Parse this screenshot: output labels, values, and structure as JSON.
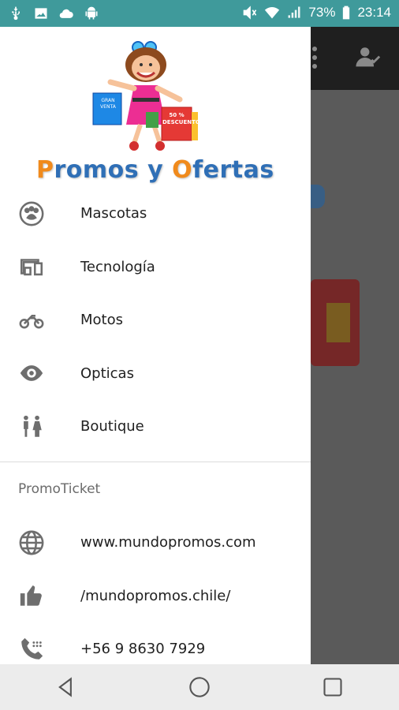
{
  "status_bar": {
    "battery": "73%",
    "time": "23:14",
    "left_icons": [
      "usb-icon",
      "image-icon",
      "cloud-icon",
      "android-icon"
    ],
    "right_icons": [
      "mute-icon",
      "wifi-icon",
      "signal-icon",
      "battery-icon"
    ]
  },
  "drawer": {
    "logo_text_1": "P",
    "logo_text_2": "romos y ",
    "logo_text_3": "O",
    "logo_text_4": "fertas",
    "logo_badge_1": "GRAN VENTA",
    "logo_badge_2": "50 % DESCUENTO",
    "categories": [
      {
        "label": "Mascotas",
        "icon": "paw-icon"
      },
      {
        "label": "Tecnología",
        "icon": "devices-icon"
      },
      {
        "label": "Motos",
        "icon": "motorcycle-icon"
      },
      {
        "label": "Opticas",
        "icon": "eye-icon"
      },
      {
        "label": "Boutique",
        "icon": "people-icon"
      }
    ],
    "section_title": "PromoTicket",
    "links": [
      {
        "label": "www.mundopromos.com",
        "icon": "globe-icon"
      },
      {
        "label": "/mundopromos.chile/",
        "icon": "thumb-up-icon"
      },
      {
        "label": "+56 9 8630 7929",
        "icon": "phone-icon"
      }
    ]
  },
  "colors": {
    "status_bar": "#3f9a9b",
    "logo_blue": "#2f6fb6",
    "logo_orange": "#f08a1c",
    "icon_gray": "#6e6e6e"
  },
  "nav_bar": {
    "buttons": [
      "back-icon",
      "home-icon",
      "recents-icon"
    ]
  }
}
